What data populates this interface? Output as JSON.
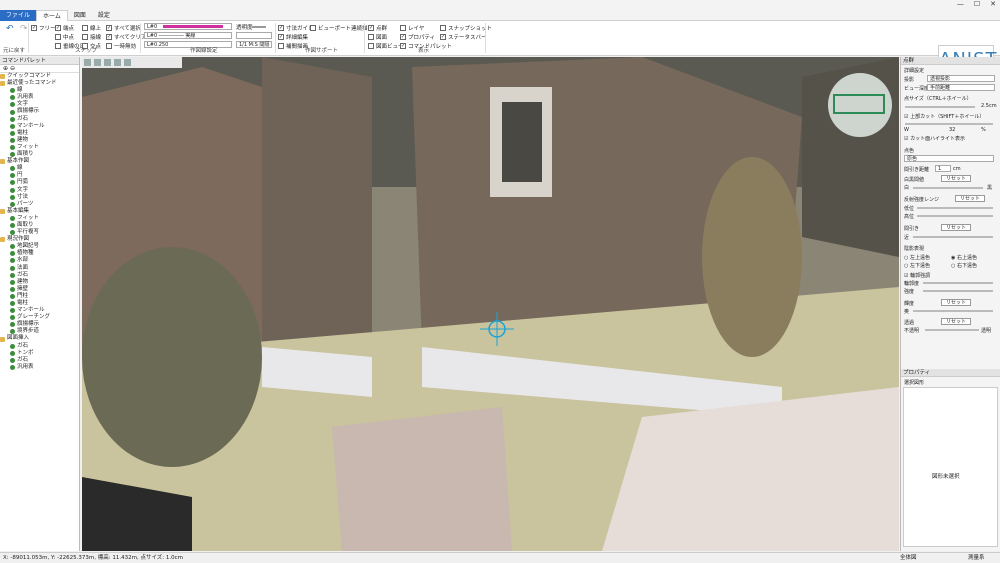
{
  "titlebar": {
    "minimize": "—",
    "maximize": "☐",
    "close": "✕"
  },
  "tabs": [
    "ファイル",
    "ホーム",
    "図面",
    "設定"
  ],
  "ribbon": {
    "undo_label": "元に戻す",
    "snap": {
      "label": "スナップ",
      "items": [
        "フリー",
        "端点",
        "中点",
        "垂線の足",
        "線上",
        "接線",
        "交点",
        "すべて選択",
        "すべてクリア",
        "一時無効"
      ]
    },
    "drawing_settings": {
      "label": "作図線設定",
      "line1": "L#0",
      "line2": "L#0 ――――― 実線",
      "line3": "L#0.250",
      "transparency_label": "透明度",
      "scale_label": "1/1 M:S 間隔"
    },
    "support": {
      "label": "作図サポート",
      "items": [
        "寸法ガイド",
        "ビューポート連続描画",
        "詳細編集",
        "補間描画"
      ]
    },
    "display": {
      "label": "表示",
      "items": [
        "点群",
        "図面",
        "図面ビュー",
        "レイヤ",
        "プロパティ",
        "コマンドパレット",
        "スナップショット",
        "ステータスバー"
      ]
    },
    "logo": "ANIST"
  },
  "palette": {
    "title": "コマンドパレット",
    "items": [
      {
        "t": "クイックコマンド",
        "f": true,
        "d": 0
      },
      {
        "t": "最近使ったコマンド",
        "f": true,
        "d": 0
      },
      {
        "t": "線",
        "f": false,
        "d": 1
      },
      {
        "t": "汎用表",
        "f": false,
        "d": 1
      },
      {
        "t": "文字",
        "f": false,
        "d": 1
      },
      {
        "t": "旗揚標示",
        "f": false,
        "d": 1
      },
      {
        "t": "ガ石",
        "f": false,
        "d": 1
      },
      {
        "t": "マンホール",
        "f": false,
        "d": 1
      },
      {
        "t": "電柱",
        "f": false,
        "d": 1
      },
      {
        "t": "建物",
        "f": false,
        "d": 1
      },
      {
        "t": "フィット",
        "f": false,
        "d": 1
      },
      {
        "t": "面積り",
        "f": false,
        "d": 1
      },
      {
        "t": "基本作図",
        "f": true,
        "d": 0
      },
      {
        "t": "線",
        "f": false,
        "d": 1
      },
      {
        "t": "円",
        "f": false,
        "d": 1
      },
      {
        "t": "円弧",
        "f": false,
        "d": 1
      },
      {
        "t": "文字",
        "f": false,
        "d": 1
      },
      {
        "t": "寸法",
        "f": false,
        "d": 1
      },
      {
        "t": "パーツ",
        "f": false,
        "d": 1
      },
      {
        "t": "基本編集",
        "f": true,
        "d": 0
      },
      {
        "t": "フィット",
        "f": false,
        "d": 1
      },
      {
        "t": "面取り",
        "f": false,
        "d": 1
      },
      {
        "t": "平行複写",
        "f": false,
        "d": 1
      },
      {
        "t": "現況作図",
        "f": true,
        "d": 0
      },
      {
        "t": "地図記号",
        "f": false,
        "d": 1
      },
      {
        "t": "植物種",
        "f": false,
        "d": 1
      },
      {
        "t": "水部",
        "f": false,
        "d": 1
      },
      {
        "t": "法面",
        "f": false,
        "d": 1
      },
      {
        "t": "ガ石",
        "f": false,
        "d": 1
      },
      {
        "t": "建物",
        "f": false,
        "d": 1
      },
      {
        "t": "擁壁",
        "f": false,
        "d": 1
      },
      {
        "t": "門柱",
        "f": false,
        "d": 1
      },
      {
        "t": "電柱",
        "f": false,
        "d": 1
      },
      {
        "t": "マンホール",
        "f": false,
        "d": 1
      },
      {
        "t": "グレーチング",
        "f": false,
        "d": 1
      },
      {
        "t": "旗揚標示",
        "f": false,
        "d": 1
      },
      {
        "t": "境界步道",
        "f": false,
        "d": 1
      },
      {
        "t": "図面挿入",
        "f": true,
        "d": 0
      },
      {
        "t": "ガ石",
        "f": false,
        "d": 1
      },
      {
        "t": "トンボ",
        "f": false,
        "d": 1
      },
      {
        "t": "ガ石",
        "f": false,
        "d": 1
      },
      {
        "t": "汎用表",
        "f": false,
        "d": 1
      }
    ]
  },
  "right_panel": {
    "title": "点群",
    "sections": {
      "detail": "詳細設定",
      "projection_label": "投影",
      "projection_value": "透視投影",
      "depth_label": "ビュー深度",
      "depth_value": "手前距離",
      "pointsize_label": "点サイズ（CTRL＋ホイール）",
      "pointsize_value": "2.5cm",
      "topcut_label": "上部カット（SHIFT＋ホイール）",
      "topcut_w": "W",
      "topcut_value": "32",
      "topcut_unit": "%",
      "highlight_label": "カット面ハイライト表示",
      "color_label": "点色",
      "color_value": "原色",
      "sparse_label": "間引き距離",
      "sparse_value": "1",
      "sparse_unit": "cm",
      "white_label": "白黒間値",
      "reset": "リセット",
      "white_sub": "白",
      "black_sub": "黒",
      "contrast_label": "反射強度レンジ",
      "gain_label": "低位",
      "high_label": "高位",
      "intensity_label": "間引き",
      "far_label": "近",
      "rgb_label": "陰影表現",
      "shade_items": [
        "左上遠色",
        "右上遠色",
        "左下遠色",
        "右下遠色"
      ],
      "outline_label": "輪郭強調",
      "outline_a": "輪郭度",
      "outline_b": "強度",
      "brightness_label": "輝度",
      "edge": "奥",
      "sat_label": "透過",
      "opacity_l": "不透明",
      "opacity_r": "透明",
      "prop_title": "プロパティ",
      "prop_sub": "選択図形",
      "empty_text": "図形未選択"
    }
  },
  "statusbar": {
    "coords": "X: -89011.053m, Y: -22625.373m, 標高: 11.432m, 点サイズ: 1.0cm",
    "layer": "全体図",
    "mode": "測量系"
  },
  "colors": {
    "accent": "#2b6cc4",
    "logo": "#3a7fb5",
    "magenta": "#d030a0"
  }
}
